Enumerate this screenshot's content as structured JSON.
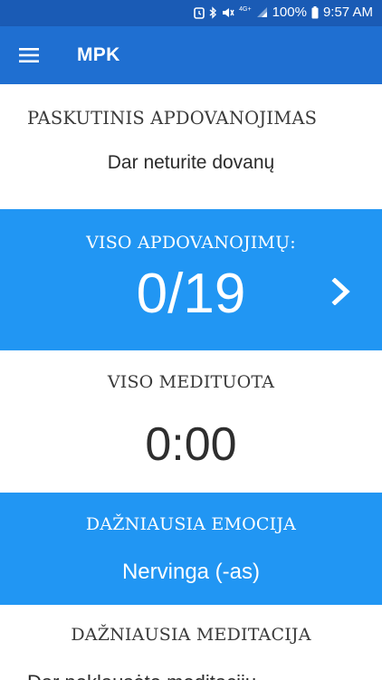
{
  "status_bar": {
    "network": "4G+",
    "battery": "100%",
    "time": "9:57 AM",
    "icons": [
      "alarm-icon",
      "bluetooth-icon",
      "mute-icon",
      "signal-icon",
      "battery-icon"
    ]
  },
  "app_bar": {
    "title": "MPK",
    "color": "#1f6fd1"
  },
  "last_award": {
    "heading": "PASKUTINIS APDOVANOJIMAS",
    "value": "Dar neturite dovanų"
  },
  "total_awards": {
    "heading": "VISO APDOVANOJIMŲ:",
    "count": "0/19",
    "color": "#2196f3"
  },
  "total_meditated": {
    "heading": "VISO MEDITUOTA",
    "value": "0:00"
  },
  "common_emotion": {
    "heading": "DAŽNIAUSIA EMOCIJA",
    "value": "Nervinga (-as)",
    "color": "#2196f3"
  },
  "common_meditation": {
    "heading": "DAŽNIAUSIA MEDITACIJA",
    "value": "Dar neklausėte meditacijų"
  }
}
